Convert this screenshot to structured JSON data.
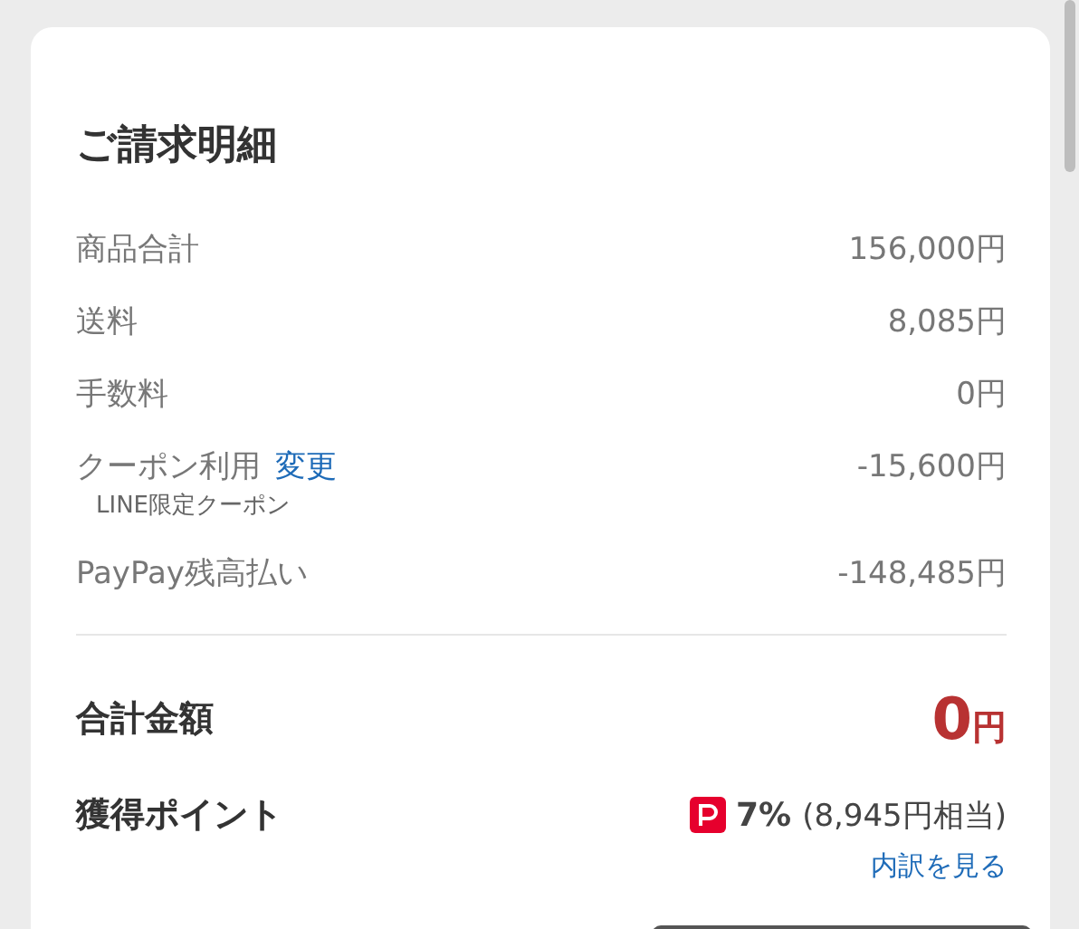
{
  "title": "ご請求明細",
  "rows": [
    {
      "label": "商品合計",
      "value": "156,000円"
    },
    {
      "label": "送料",
      "value": "8,085円"
    },
    {
      "label": "手数料",
      "value": "0円"
    },
    {
      "label": "クーポン利用",
      "link": "変更",
      "value": "-15,600円",
      "note": "LINE限定クーポン"
    },
    {
      "label": "PayPay残高払い",
      "value": "-148,485円"
    }
  ],
  "total": {
    "label": "合計金額",
    "amount": "0",
    "unit": "円"
  },
  "points": {
    "label": "獲得ポイント",
    "rate": "7%",
    "equivalent": "(8,945円相当)",
    "link": "内訳を見る"
  }
}
